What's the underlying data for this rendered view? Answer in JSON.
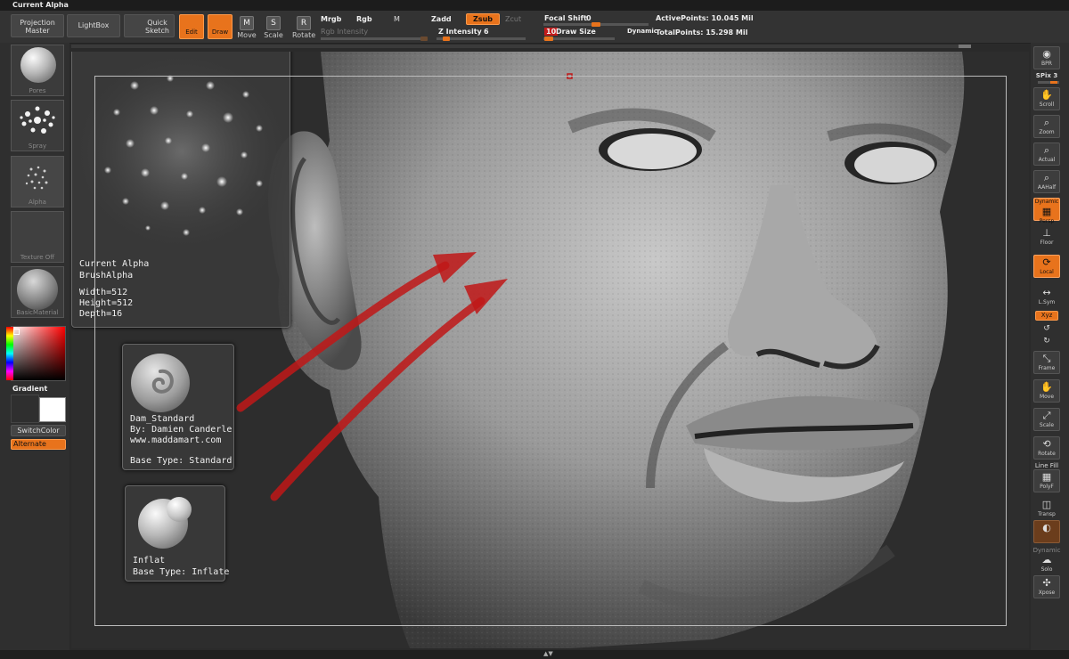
{
  "title": "Current Alpha",
  "top": {
    "projection_master": "Projection Master",
    "lightbox": "LightBox",
    "quick_sketch": "Quick Sketch",
    "edit": "Edit",
    "draw": "Draw",
    "move": "Move",
    "scale": "Scale",
    "rotate": "Rotate",
    "mrgb": "Mrgb",
    "rgb": "Rgb",
    "m": "M",
    "zadd": "Zadd",
    "zsub": "Zsub",
    "zcut": "Zcut",
    "rgb_intensity": "Rgb Intensity",
    "z_intensity": "Z Intensity",
    "z_intensity_value": "6",
    "focal_shift": "Focal Shift",
    "focal_shift_value": "0",
    "draw_size": "Draw Size",
    "draw_size_value": "10",
    "dynamic": "Dynamic",
    "active_points": "ActivePoints: 10.045 Mil",
    "total_points": "TotalPoints: 15.298 Mil",
    "z_intensity_level": 0.08,
    "focal_shift_level": 0.5,
    "draw_size_level": 0.02
  },
  "left": {
    "pores_label": "Pores",
    "spray_label": "Spray",
    "alpha_label": "Alpha",
    "texture_label": "Texture Off",
    "material_label": "BasicMaterial",
    "gradient_label": "Gradient",
    "switchcolor_label": "SwitchColor",
    "alternate_label": "Alternate"
  },
  "alpha_popup": {
    "line1": "Current Alpha",
    "line2": "BrushAlpha",
    "width": "Width=512",
    "height": "Height=512",
    "depth": "Depth=16"
  },
  "brush1": {
    "name": "Dam_Standard",
    "by": "By: Damien Canderle",
    "url": "www.maddamart.com",
    "base": "Base Type: Standard"
  },
  "brush2": {
    "name": "Inflat",
    "base": "Base Type: Inflate"
  },
  "right": {
    "bpr": "BPR",
    "spix": "SPix 3",
    "scroll": "Scroll",
    "zoom": "Zoom",
    "actual": "Actual",
    "aahalf": "AAHalf",
    "dynamic": "Dynamic",
    "persp": "Persp",
    "floor": "Floor",
    "local": "Local",
    "lsym": "L.Sym",
    "xyz": "Xyz",
    "frame": "Frame",
    "move": "Move",
    "scale": "Scale",
    "rotate": "Rotate",
    "line_fill": "Line Fill",
    "polyf": "PolyF",
    "transp": "Transp",
    "dynamic2": "Dynamic",
    "solo": "Solo",
    "xpose": "Xpose"
  },
  "colors": {
    "accent": "#e8731c",
    "arrow": "#c01818"
  }
}
